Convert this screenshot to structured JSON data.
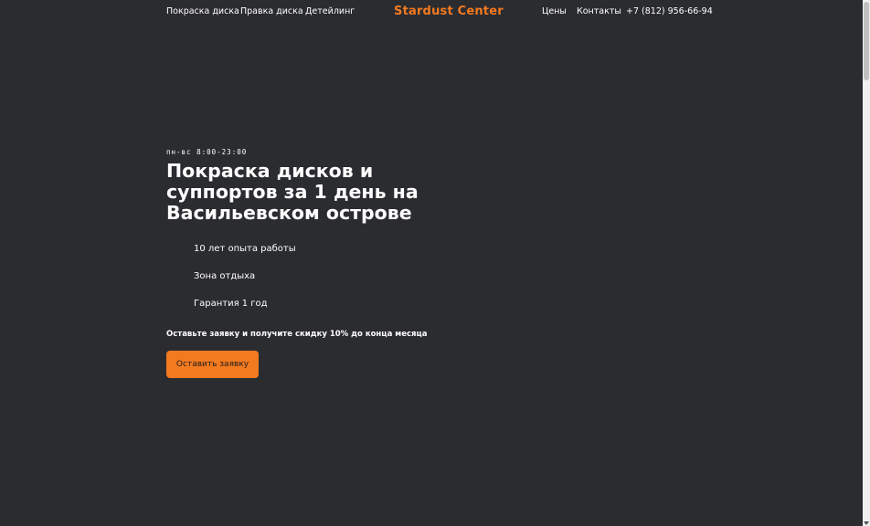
{
  "header": {
    "nav_left": [
      "Покраска диска",
      "Правка диска",
      "Детейлинг"
    ],
    "logo": "Stardust Center",
    "nav_right": [
      "Цены",
      "Контакты"
    ],
    "phone": "+7 (812) 956-66-94"
  },
  "hero": {
    "hours": "пн-вс 8:00-23:00",
    "title": "Покраска дисков и суппортов за 1 день на Васильевском острове",
    "features": [
      "10 лет опыта работы",
      "Зона отдыха",
      "Гарантия 1 год"
    ],
    "offer": "Оставьте заявку и получите скидку 10% до конца месяца",
    "cta_label": "Оставить заявку"
  },
  "colors": {
    "background": "#2b2c30",
    "accent": "#f47a20",
    "text": "#ffffff"
  }
}
